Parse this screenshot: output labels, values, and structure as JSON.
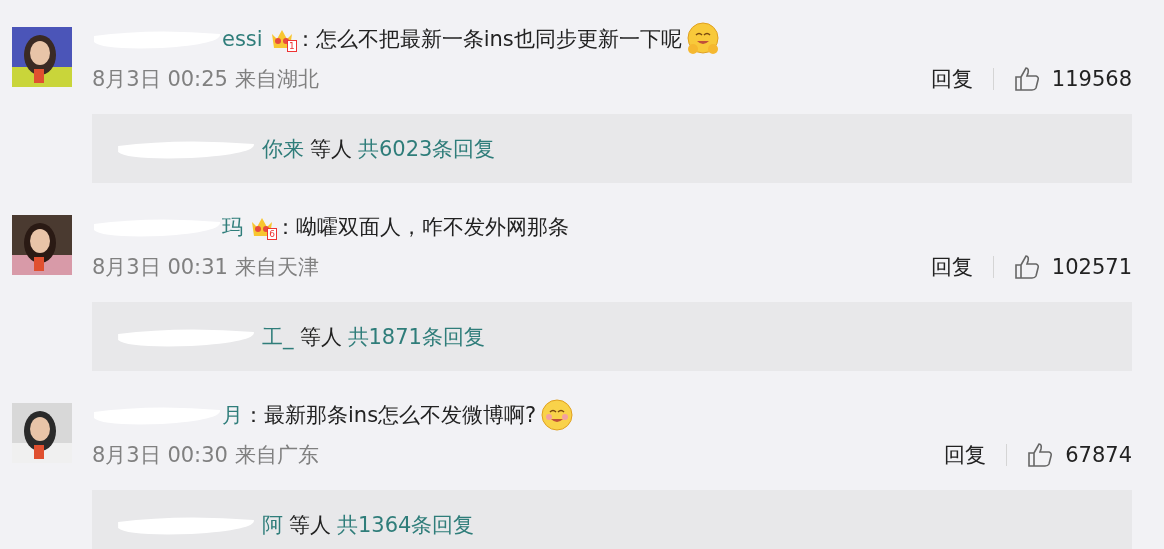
{
  "comments": [
    {
      "user": "essi",
      "badge": "1",
      "text": "：怎么不把最新一条ins也同步更新一下呢",
      "emoji": {
        "kind": "hug"
      },
      "date": "8月3日 00:25 来自湖北",
      "reply_label": "回复",
      "likes": "119568",
      "replies": {
        "users": "你来",
        "suffix": "等人",
        "total": "共6023条回复"
      }
    },
    {
      "user": "玛",
      "badge": "6",
      "text": "：呦嚯双面人，咋不发外网那条",
      "date": "8月3日 00:31 来自天津",
      "reply_label": "回复",
      "likes": "102571",
      "replies": {
        "users": "工_",
        "suffix": "等人",
        "total": "共1871条回复"
      }
    },
    {
      "user": "月",
      "text": "：最新那条ins怎么不发微博啊?",
      "emoji": {
        "kind": "smile"
      },
      "date": "8月3日 00:30 来自广东",
      "reply_label": "回复",
      "likes": "67874",
      "replies": {
        "users": "阿",
        "suffix": "等人",
        "total": "共1364条回复"
      }
    }
  ]
}
